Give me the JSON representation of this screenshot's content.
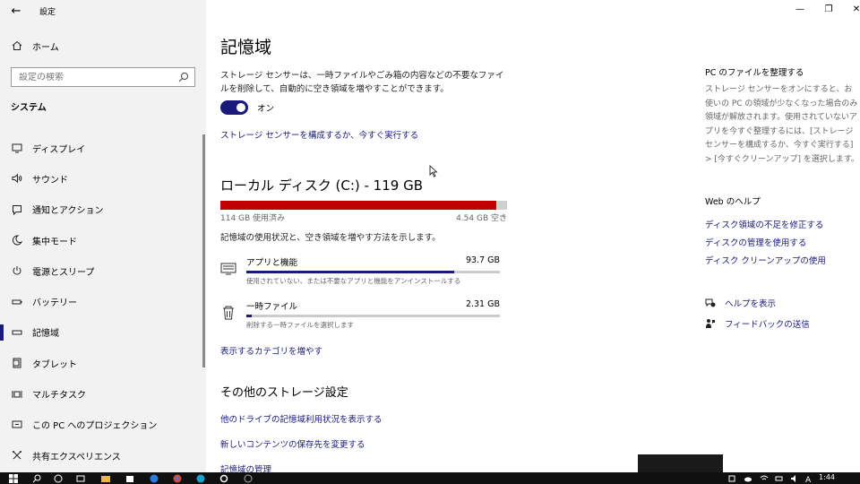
{
  "app": {
    "title": "設定",
    "back": "←"
  },
  "window_controls": {
    "minimize": "—",
    "maximize": "❐",
    "close": "✕"
  },
  "sidebar": {
    "home": "ホーム",
    "search_placeholder": "設定の検索",
    "group": "システム",
    "items": [
      {
        "label": "ディスプレイ",
        "icon": "display-icon"
      },
      {
        "label": "サウンド",
        "icon": "sound-icon"
      },
      {
        "label": "通知とアクション",
        "icon": "notification-icon"
      },
      {
        "label": "集中モード",
        "icon": "moon-icon"
      },
      {
        "label": "電源とスリープ",
        "icon": "power-icon"
      },
      {
        "label": "バッテリー",
        "icon": "battery-icon"
      },
      {
        "label": "記憶域",
        "icon": "storage-icon",
        "active": true
      },
      {
        "label": "タブレット",
        "icon": "tablet-icon"
      },
      {
        "label": "マルチタスク",
        "icon": "multitask-icon"
      },
      {
        "label": "この PC へのプロジェクション",
        "icon": "projection-icon"
      },
      {
        "label": "共有エクスペリエンス",
        "icon": "share-icon"
      }
    ]
  },
  "main": {
    "title": "記憶域",
    "description": "ストレージ センサーは、一時ファイルやごみ箱の内容などの不要なファイルを削除して、自動的に空き領域を増やすことができます。",
    "toggle_label": "オン",
    "sense_link": "ストレージ センサーを構成するか、今すぐ実行する",
    "disk": {
      "title": "ローカル ディスク (C:) - 119 GB",
      "used": "114 GB 使用済み",
      "free": "4.54 GB 空き",
      "used_fraction": 0.962
    },
    "disk_desc": "記憶域の使用状況と、空き領域を増やす方法を示します。",
    "categories": [
      {
        "name": "アプリと機能",
        "size": "93.7 GB",
        "sub": "使用されていない、または不要なアプリと機能をアンインストールする",
        "fraction": 0.82,
        "icon": "apps-icon"
      },
      {
        "name": "一時ファイル",
        "size": "2.31 GB",
        "sub": "削除する一時ファイルを選択します",
        "fraction": 0.02,
        "icon": "trash-icon"
      }
    ],
    "more_categories": "表示するカテゴリを増やす",
    "other_title": "その他のストレージ設定",
    "other_links": [
      "他のドライブの記憶域利用状況を表示する",
      "新しいコンテンツの保存先を変更する",
      "記憶域の管理"
    ]
  },
  "right": {
    "title": "PC のファイルを整理する",
    "desc": "ストレージ センサーをオンにすると、お使いの PC の領域が少なくなった場合のみ領域が解放されます。使用されていないアプリを今すぐ整理するには、[ストレージ センサーを構成するか、今すぐ実行する] > [今すぐクリーンアップ] を選択します。",
    "web_help": "Web のヘルプ",
    "links": [
      "ディスク領域の不足を修正する",
      "ディスクの管理を使用する",
      "ディスク クリーンアップの使用"
    ],
    "help": "ヘルプを表示",
    "feedback": "フィードバックの送信"
  },
  "taskbar": {
    "clock": "1:44"
  }
}
